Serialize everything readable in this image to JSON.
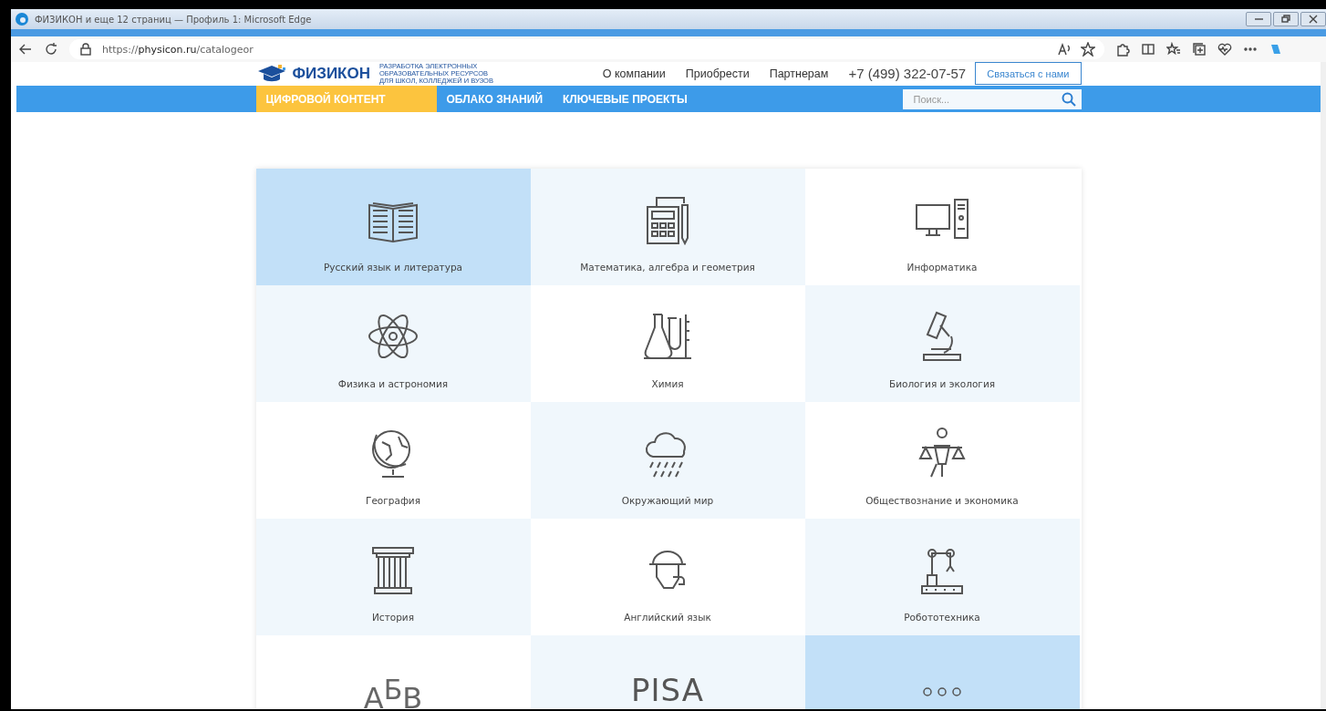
{
  "browser": {
    "title": "ФИЗИКОН и еще 12 страниц — Профиль 1: Microsoft Edge",
    "url": "https://**physicon.ru**/catalogeor"
  },
  "header": {
    "logo": "ФИЗИКОН",
    "tagline": [
      "РАЗРАБОТКА ЭЛЕКТРОННЫХ",
      "ОБРАЗОВАТЕЛЬНЫХ РЕСУРСОВ",
      "ДЛЯ ШКОЛ, КОЛЛЕДЖЕЙ И ВУЗОВ"
    ],
    "links": [
      "О компании",
      "Приобрести",
      "Партнерам"
    ],
    "phone": "+7 (499) 322-07-57",
    "contact_button": "Связаться с нами"
  },
  "nav": {
    "tabs": [
      {
        "label": "ЦИФРОВОЙ КОНТЕНТ",
        "selected": true
      },
      {
        "label": "ОБЛАКО ЗНАНИЙ",
        "selected": false
      },
      {
        "label": "КЛЮЧЕВЫЕ ПРОЕКТЫ",
        "selected": false
      }
    ],
    "search": {
      "placeholder": "Поиск..."
    }
  },
  "catalog": {
    "tiles": [
      {
        "kind": "book",
        "label": "Русский язык и литература",
        "highlighted": true
      },
      {
        "kind": "calculator",
        "label": "Математика, алгебра и геометрия",
        "highlighted": false
      },
      {
        "kind": "computer",
        "label": "Информатика",
        "highlighted": false
      },
      {
        "kind": "atom",
        "label": "Физика и астрономия",
        "highlighted": false
      },
      {
        "kind": "flasks",
        "label": "Химия",
        "highlighted": false
      },
      {
        "kind": "microscope",
        "label": "Биология и экология",
        "highlighted": false
      },
      {
        "kind": "globe",
        "label": "География",
        "highlighted": false
      },
      {
        "kind": "cloud",
        "label": "Окружающий мир",
        "highlighted": false
      },
      {
        "kind": "scales",
        "label": "Обществознание и экономика",
        "highlighted": false
      },
      {
        "kind": "column",
        "label": "История",
        "highlighted": false
      },
      {
        "kind": "detective",
        "label": "Английский язык",
        "highlighted": false
      },
      {
        "kind": "robot",
        "label": "Робототехника",
        "highlighted": false
      },
      {
        "kind": "letters",
        "icon_text": "А$^{Б}$В",
        "highlighted": false
      },
      {
        "kind": "wordmark",
        "icon_text": "PISA",
        "highlighted": false
      },
      {
        "kind": "more",
        "highlighted": true
      }
    ]
  }
}
